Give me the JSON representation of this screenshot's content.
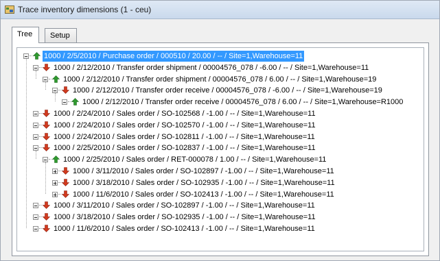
{
  "window": {
    "title": "Trace inventory dimensions (1 - ceu)"
  },
  "tabs": [
    {
      "label": "Tree",
      "active": true
    },
    {
      "label": "Setup",
      "active": false
    }
  ],
  "icons": {
    "receipt": "green-up-arrow-icon",
    "issue": "red-down-arrow-icon"
  },
  "colors": {
    "receipt": "#2f9a2f",
    "issue": "#d23a1e",
    "selection": "#3399ff"
  },
  "tree": [
    {
      "level": 0,
      "expander": "minus",
      "direction": "up",
      "selected": true,
      "label": "1000 / 2/5/2010 / Purchase order / 000510 / 20.00 / -- / Site=1,Warehouse=11"
    },
    {
      "level": 1,
      "expander": "minus",
      "direction": "down",
      "selected": false,
      "label": "1000 / 2/12/2010 / Transfer order shipment / 00004576_078 / -6.00 / -- / Site=1,Warehouse=11"
    },
    {
      "level": 2,
      "expander": "minus",
      "direction": "up",
      "selected": false,
      "label": "1000 / 2/12/2010 / Transfer order shipment / 00004576_078 / 6.00 / -- / Site=1,Warehouse=19"
    },
    {
      "level": 3,
      "expander": "minus",
      "direction": "down",
      "selected": false,
      "label": "1000 / 2/12/2010 / Transfer order receive / 00004576_078 / -6.00 / -- / Site=1,Warehouse=19"
    },
    {
      "level": 4,
      "expander": "minus",
      "direction": "up",
      "selected": false,
      "label": "1000 / 2/12/2010 / Transfer order receive / 00004576_078 / 6.00 / -- / Site=1,Warehouse=R1000"
    },
    {
      "level": 1,
      "expander": "minus",
      "direction": "down",
      "selected": false,
      "label": "1000 / 2/24/2010 / Sales order / SO-102568 / -1.00 / -- / Site=1,Warehouse=11"
    },
    {
      "level": 1,
      "expander": "minus",
      "direction": "down",
      "selected": false,
      "label": "1000 / 2/24/2010 / Sales order / SO-102570 / -1.00 / -- / Site=1,Warehouse=11"
    },
    {
      "level": 1,
      "expander": "minus",
      "direction": "down",
      "selected": false,
      "label": "1000 / 2/24/2010 / Sales order / SO-102811 / -1.00 / -- / Site=1,Warehouse=11"
    },
    {
      "level": 1,
      "expander": "minus",
      "direction": "down",
      "selected": false,
      "label": "1000 / 2/25/2010 / Sales order / SO-102837 / -1.00 / -- / Site=1,Warehouse=11"
    },
    {
      "level": 2,
      "expander": "minus",
      "direction": "up",
      "selected": false,
      "label": "1000 / 2/25/2010 / Sales order / RET-000078 / 1.00 / -- / Site=1,Warehouse=11"
    },
    {
      "level": 3,
      "expander": "plus",
      "direction": "down",
      "selected": false,
      "label": "1000 / 3/11/2010 / Sales order / SO-102897 / -1.00 / -- / Site=1,Warehouse=11"
    },
    {
      "level": 3,
      "expander": "plus",
      "direction": "down",
      "selected": false,
      "label": "1000 / 3/18/2010 / Sales order / SO-102935 / -1.00 / -- / Site=1,Warehouse=11"
    },
    {
      "level": 3,
      "expander": "plus",
      "direction": "down",
      "selected": false,
      "label": "1000 / 11/6/2010 / Sales order / SO-102413 / -1.00 / -- / Site=1,Warehouse=11"
    },
    {
      "level": 1,
      "expander": "minus",
      "direction": "down",
      "selected": false,
      "label": "1000 / 3/11/2010 / Sales order / SO-102897 / -1.00 / -- / Site=1,Warehouse=11"
    },
    {
      "level": 1,
      "expander": "minus",
      "direction": "down",
      "selected": false,
      "label": "1000 / 3/18/2010 / Sales order / SO-102935 / -1.00 / -- / Site=1,Warehouse=11"
    },
    {
      "level": 1,
      "expander": "minus",
      "direction": "down",
      "selected": false,
      "label": "1000 / 11/6/2010 / Sales order / SO-102413 / -1.00 / -- / Site=1,Warehouse=11"
    }
  ]
}
